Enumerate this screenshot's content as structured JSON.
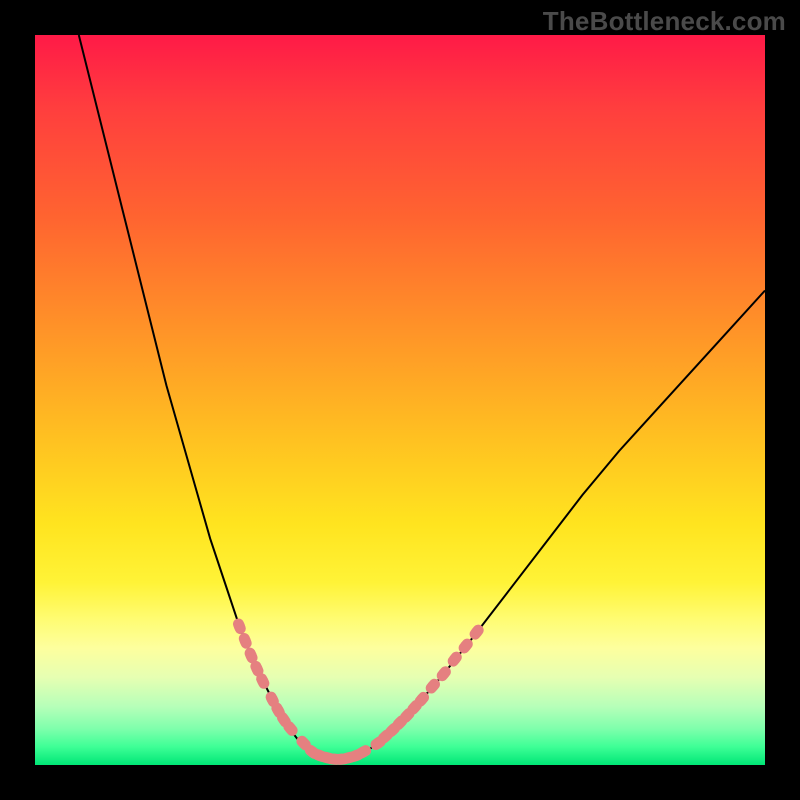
{
  "watermark": "TheBottleneck.com",
  "colors": {
    "frame": "#000000",
    "curve": "#000000",
    "marker_fill": "#e58080",
    "marker_stroke": "#d66d6d"
  },
  "chart_data": {
    "type": "line",
    "title": "",
    "xlabel": "",
    "ylabel": "",
    "xlim": [
      0,
      100
    ],
    "ylim": [
      0,
      100
    ],
    "grid": false,
    "legend": false,
    "note": "Bottleneck-style V curve; x is a relative hardware balance index, y is bottleneck percentage. Values estimated from pixels.",
    "series": [
      {
        "name": "left_branch",
        "x": [
          6,
          8,
          10,
          12,
          14,
          16,
          18,
          20,
          22,
          24,
          26,
          28,
          29,
          30,
          31,
          32,
          33,
          34,
          35,
          36,
          37,
          38
        ],
        "y": [
          100,
          92,
          84,
          76,
          68,
          60,
          52,
          45,
          38,
          31,
          25,
          19,
          16.5,
          14,
          12,
          10,
          8,
          6.3,
          4.8,
          3.5,
          2.5,
          1.6
        ]
      },
      {
        "name": "valley",
        "x": [
          38,
          39,
          40,
          41,
          42,
          43,
          44,
          45
        ],
        "y": [
          1.6,
          1.1,
          0.8,
          0.7,
          0.7,
          0.8,
          1.1,
          1.6
        ]
      },
      {
        "name": "right_branch",
        "x": [
          45,
          47,
          49,
          51,
          53,
          56,
          60,
          65,
          70,
          75,
          80,
          85,
          90,
          95,
          100
        ],
        "y": [
          1.6,
          3.0,
          4.8,
          6.8,
          9.0,
          12.5,
          17.5,
          24.0,
          30.5,
          37.0,
          43.0,
          48.5,
          54.0,
          59.5,
          65.0
        ]
      }
    ],
    "markers": {
      "name": "highlighted_points",
      "shape": "rounded",
      "points": [
        {
          "x": 28.0,
          "y": 19.0
        },
        {
          "x": 28.8,
          "y": 17.0
        },
        {
          "x": 29.6,
          "y": 15.0
        },
        {
          "x": 30.4,
          "y": 13.2
        },
        {
          "x": 31.2,
          "y": 11.5
        },
        {
          "x": 32.5,
          "y": 9.0
        },
        {
          "x": 33.3,
          "y": 7.5
        },
        {
          "x": 34.1,
          "y": 6.2
        },
        {
          "x": 35.0,
          "y": 5.0
        },
        {
          "x": 36.8,
          "y": 3.0
        },
        {
          "x": 38.0,
          "y": 1.8
        },
        {
          "x": 39.0,
          "y": 1.3
        },
        {
          "x": 40.0,
          "y": 1.0
        },
        {
          "x": 41.0,
          "y": 0.8
        },
        {
          "x": 42.0,
          "y": 0.8
        },
        {
          "x": 43.0,
          "y": 1.0
        },
        {
          "x": 44.0,
          "y": 1.3
        },
        {
          "x": 45.0,
          "y": 1.8
        },
        {
          "x": 47.0,
          "y": 3.0
        },
        {
          "x": 48.0,
          "y": 3.9
        },
        {
          "x": 49.0,
          "y": 4.8
        },
        {
          "x": 50.0,
          "y": 5.8
        },
        {
          "x": 51.0,
          "y": 6.8
        },
        {
          "x": 52.0,
          "y": 7.9
        },
        {
          "x": 53.0,
          "y": 9.0
        },
        {
          "x": 54.5,
          "y": 10.8
        },
        {
          "x": 56.0,
          "y": 12.5
        },
        {
          "x": 57.5,
          "y": 14.5
        },
        {
          "x": 59.0,
          "y": 16.3
        },
        {
          "x": 60.5,
          "y": 18.2
        }
      ]
    }
  }
}
